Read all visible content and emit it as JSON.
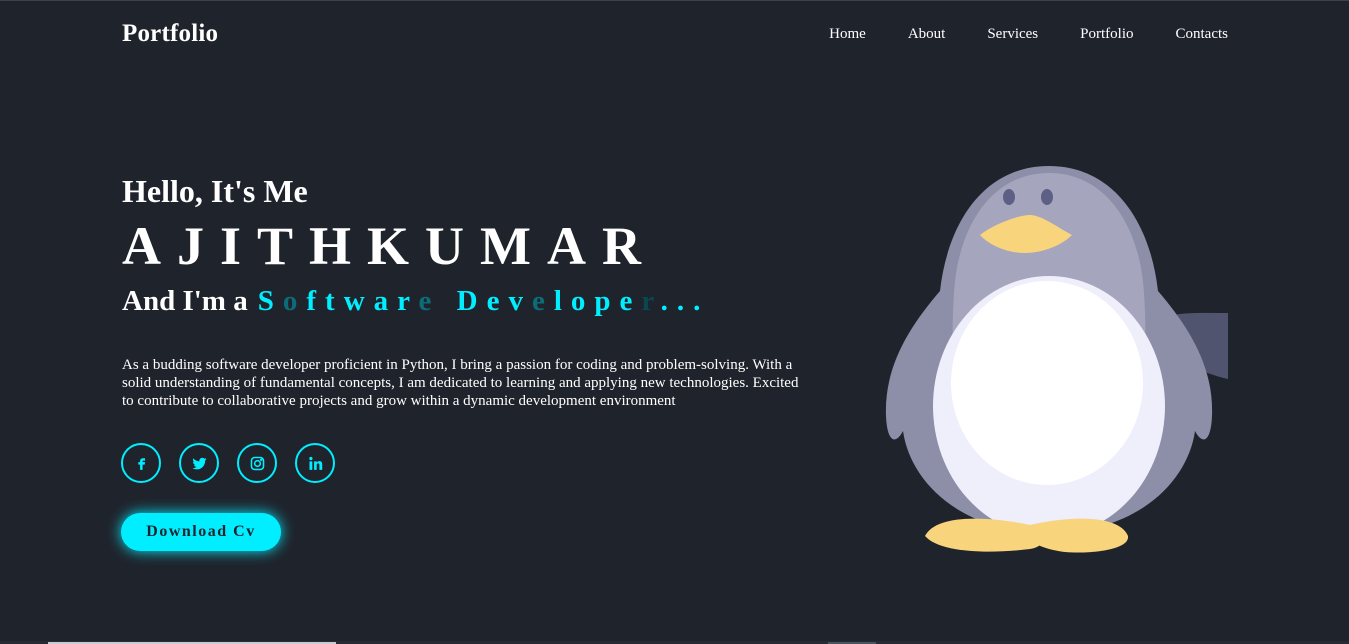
{
  "header": {
    "logo": "Portfolio",
    "nav": [
      "Home",
      "About",
      "Services",
      "Portfolio",
      "Contacts"
    ]
  },
  "hero": {
    "greeting": "Hello, It's Me",
    "name": "AJITHKUMAR",
    "role_prefix": "And I'm a",
    "role_typed": "Software Developer...",
    "bio": "As a budding software developer proficient in Python, I bring a passion for coding and problem-solving. With a solid understanding of fundamental concepts, I am dedicated to learning and applying new technologies. Excited to contribute to collaborative projects and grow within a dynamic development environment",
    "download_label": "Download Cv"
  },
  "socials": [
    {
      "icon": "facebook-icon"
    },
    {
      "icon": "twitter-icon"
    },
    {
      "icon": "instagram-icon"
    },
    {
      "icon": "linkedin-icon"
    }
  ],
  "colors": {
    "background": "#1f232c",
    "accent": "#00eeff",
    "text": "#ffffff"
  }
}
